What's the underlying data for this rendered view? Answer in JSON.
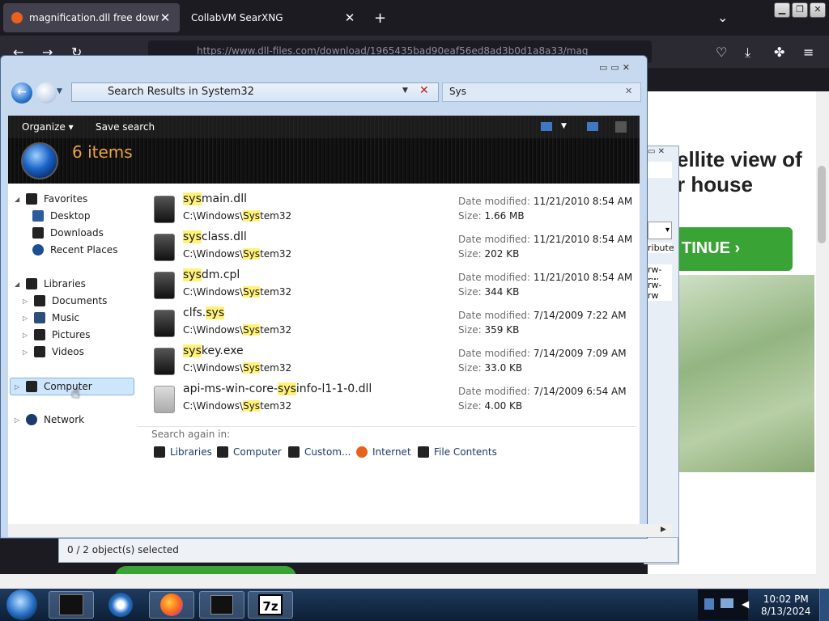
{
  "browser": {
    "tabs": [
      {
        "title": "magnification.dll free downloa",
        "active": true
      },
      {
        "title": "CollabVM SearXNG",
        "active": false
      }
    ],
    "url": "https://www.dll-files.com/download/1965435bad90eaf56ed8ad3b0d1a8a33/mag",
    "new_tab_glyph": "+",
    "menu_glyph": "≡"
  },
  "webpage": {
    "headline": "ellite view of\nr house",
    "cta_label": "TINUE ›",
    "side_text_1": "ribute",
    "side_text_2": "rw-rw",
    "side_text_3": "rw-rw"
  },
  "explorer": {
    "address": "Search Results in System32",
    "search_query": "Sys",
    "toolbar": {
      "organize": "Organize ▾",
      "save_search": "Save search"
    },
    "item_count": "6 items",
    "nav": {
      "favorites": "Favorites",
      "desktop": "Desktop",
      "downloads": "Downloads",
      "recent": "Recent Places",
      "libraries": "Libraries",
      "documents": "Documents",
      "music": "Music",
      "pictures": "Pictures",
      "videos": "Videos",
      "computer": "Computer",
      "network": "Network"
    },
    "files": [
      {
        "pre": "",
        "hl": "sys",
        "post": "main.dll",
        "path_pre": "C:\\Windows\\",
        "path_hl": "Sys",
        "path_post": "tem32",
        "date": "11/21/2010 8:54 AM",
        "size": "1.66 MB"
      },
      {
        "pre": "",
        "hl": "sys",
        "post": "class.dll",
        "path_pre": "C:\\Windows\\",
        "path_hl": "Sys",
        "path_post": "tem32",
        "date": "11/21/2010 8:54 AM",
        "size": "202 KB"
      },
      {
        "pre": "",
        "hl": "sys",
        "post": "dm.cpl",
        "path_pre": "C:\\Windows\\",
        "path_hl": "Sys",
        "path_post": "tem32",
        "date": "11/21/2010 8:54 AM",
        "size": "344 KB"
      },
      {
        "pre": "clfs.",
        "hl": "sys",
        "post": "",
        "path_pre": "C:\\Windows\\",
        "path_hl": "Sys",
        "path_post": "tem32",
        "date": "7/14/2009 7:22 AM",
        "size": "359 KB"
      },
      {
        "pre": "",
        "hl": "sys",
        "post": "key.exe",
        "path_pre": "C:\\Windows\\",
        "path_hl": "Sys",
        "path_post": "tem32",
        "date": "7/14/2009 7:09 AM",
        "size": "33.0 KB"
      },
      {
        "pre": "api-ms-win-core-",
        "hl": "sys",
        "post": "info-l1-1-0.dll",
        "path_pre": "C:\\Windows\\",
        "path_hl": "Sys",
        "path_post": "tem32",
        "date": "7/14/2009 6:54 AM",
        "size": "4.00 KB"
      }
    ],
    "date_label": "Date modified:",
    "size_label": "Size:",
    "search_again": {
      "label": "Search again in:",
      "items": [
        "Libraries",
        "Computer",
        "Custom...",
        "Internet",
        "File Contents"
      ]
    },
    "status": "0 / 2 object(s) selected"
  },
  "taskbar": {
    "time": "10:02 PM",
    "date": "8/13/2024",
    "sevenzip_label": "7z"
  }
}
